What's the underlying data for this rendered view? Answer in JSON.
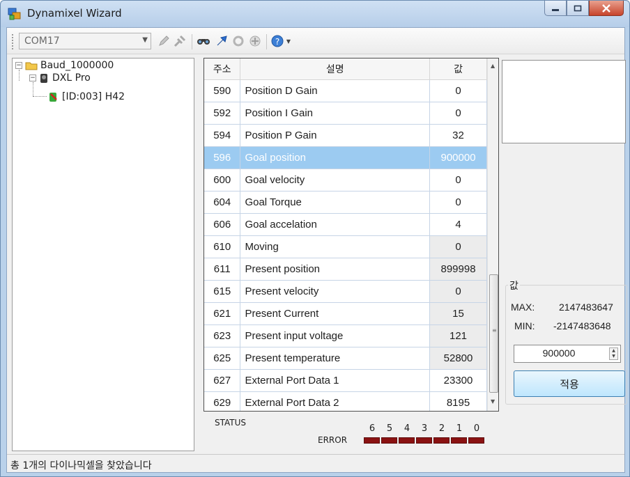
{
  "window": {
    "title": "Dynamixel Wizard"
  },
  "toolbar": {
    "port_value": "COM17"
  },
  "tree": {
    "root_label": "Baud_1000000",
    "model_label": "DXL Pro",
    "device_label": "[ID:003] H42"
  },
  "grid": {
    "headers": {
      "address": "주소",
      "description": "설명",
      "value": "값"
    },
    "rows": [
      {
        "address": "590",
        "description": "Position D Gain",
        "value": "0",
        "readonly": false
      },
      {
        "address": "592",
        "description": "Position I Gain",
        "value": "0",
        "readonly": false
      },
      {
        "address": "594",
        "description": "Position P Gain",
        "value": "32",
        "readonly": false
      },
      {
        "address": "596",
        "description": "Goal position",
        "value": "900000",
        "readonly": false,
        "selected": true
      },
      {
        "address": "600",
        "description": "Goal velocity",
        "value": "0",
        "readonly": false
      },
      {
        "address": "604",
        "description": "Goal Torque",
        "value": "0",
        "readonly": false
      },
      {
        "address": "606",
        "description": "Goal accelation",
        "value": "4",
        "readonly": false
      },
      {
        "address": "610",
        "description": "Moving",
        "value": "0",
        "readonly": true
      },
      {
        "address": "611",
        "description": "Present position",
        "value": "899998",
        "readonly": true
      },
      {
        "address": "615",
        "description": "Present velocity",
        "value": "0",
        "readonly": true
      },
      {
        "address": "621",
        "description": "Present Current",
        "value": "15",
        "readonly": true
      },
      {
        "address": "623",
        "description": "Present input voltage",
        "value": "121",
        "readonly": true
      },
      {
        "address": "625",
        "description": "Present temperature",
        "value": "52800",
        "readonly": true
      },
      {
        "address": "627",
        "description": "External Port Data 1",
        "value": "23300",
        "readonly": false
      },
      {
        "address": "629",
        "description": "External Port Data 2",
        "value": "8195",
        "readonly": false
      }
    ]
  },
  "status": {
    "label": "STATUS",
    "error_label": "ERROR",
    "bits": [
      "6",
      "5",
      "4",
      "3",
      "2",
      "1",
      "0"
    ],
    "led_color": "#8a1212"
  },
  "value_panel": {
    "title": "값",
    "max_label": "MAX:",
    "max_value": "2147483647",
    "min_label": "MIN:",
    "min_value": "-2147483648",
    "input_value": "900000",
    "apply_label": "적용"
  },
  "statusbar": {
    "text": "총 1개의 다이나믹셀을 찾았습니다"
  },
  "colors": {
    "selection": "#9ccbf1",
    "accent": "#3c7fb1"
  }
}
